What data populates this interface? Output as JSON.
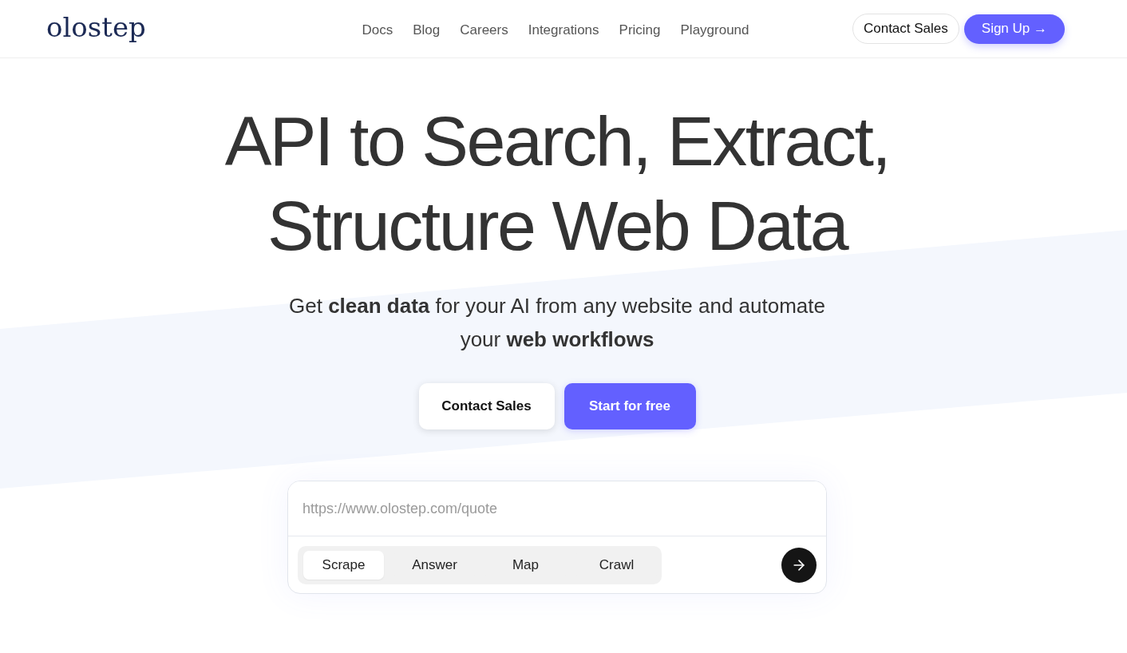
{
  "logo": {
    "text": "olostep"
  },
  "nav": {
    "links": [
      "Docs",
      "Blog",
      "Careers",
      "Integrations",
      "Pricing",
      "Playground"
    ],
    "contact_button": "Contact Sales",
    "signup_button": "Sign Up →"
  },
  "hero": {
    "title": "API to Search, Extract, Structure Web Data",
    "subtitle": "Get **clean data** for your AI from any website and automate your **web workflows**",
    "buttons": [
      {
        "label": "Contact Sales",
        "kind": "secondary"
      },
      {
        "label": "Start for free",
        "kind": "primary"
      }
    ]
  },
  "query": {
    "placeholder": "https://www.olostep.com/quote",
    "modes": [
      {
        "label": "Scrape",
        "selected": true
      },
      {
        "label": "Answer",
        "selected": false
      },
      {
        "label": "Map",
        "selected": false
      },
      {
        "label": "Crawl",
        "selected": false
      }
    ]
  }
}
